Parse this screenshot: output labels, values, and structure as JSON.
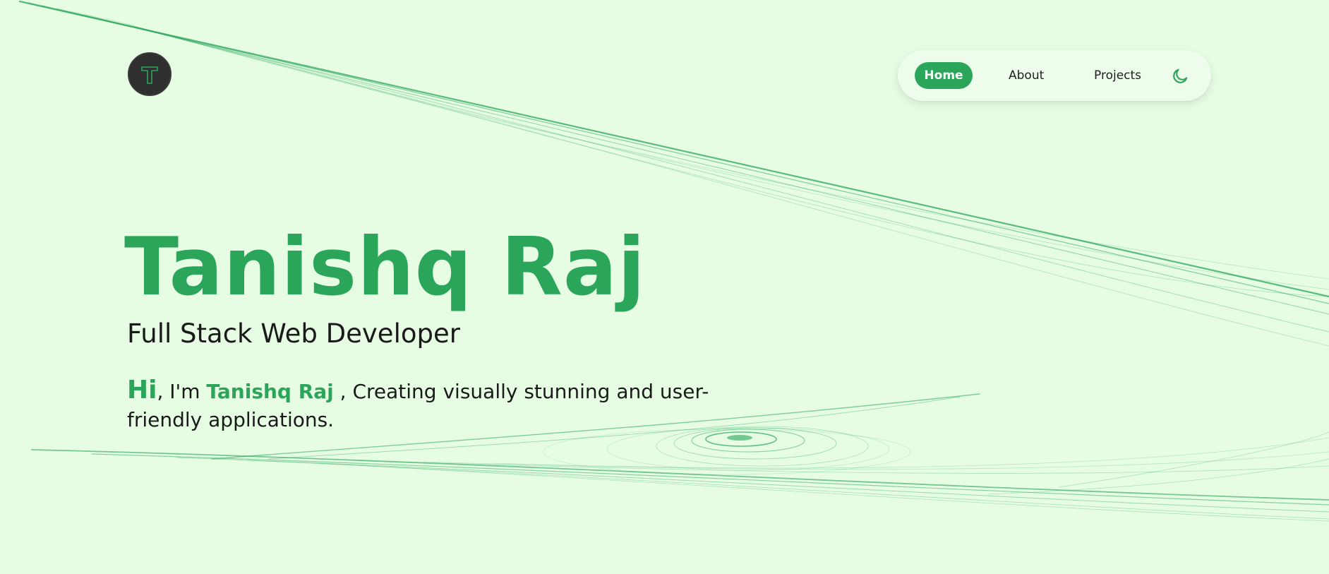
{
  "logo": {
    "letter": "T",
    "icon": "t-letter-logo-icon"
  },
  "nav": {
    "items": [
      {
        "label": "Home",
        "active": true
      },
      {
        "label": "About",
        "active": false
      },
      {
        "label": "Projects",
        "active": false
      }
    ],
    "theme_toggle_icon": "moon-icon"
  },
  "hero": {
    "name": "Tanishq Raj",
    "role": "Full Stack Web Developer",
    "intro": {
      "hi": "Hi",
      "im": ", I'm ",
      "name": "Tanishq Raj",
      "rest": " , Creating visually stunning and user-friendly applications."
    }
  },
  "colors": {
    "background": "#e6fde3",
    "accent": "#2aa55a",
    "text": "#1a1a1a",
    "logo_bg": "#2f2f2f"
  }
}
